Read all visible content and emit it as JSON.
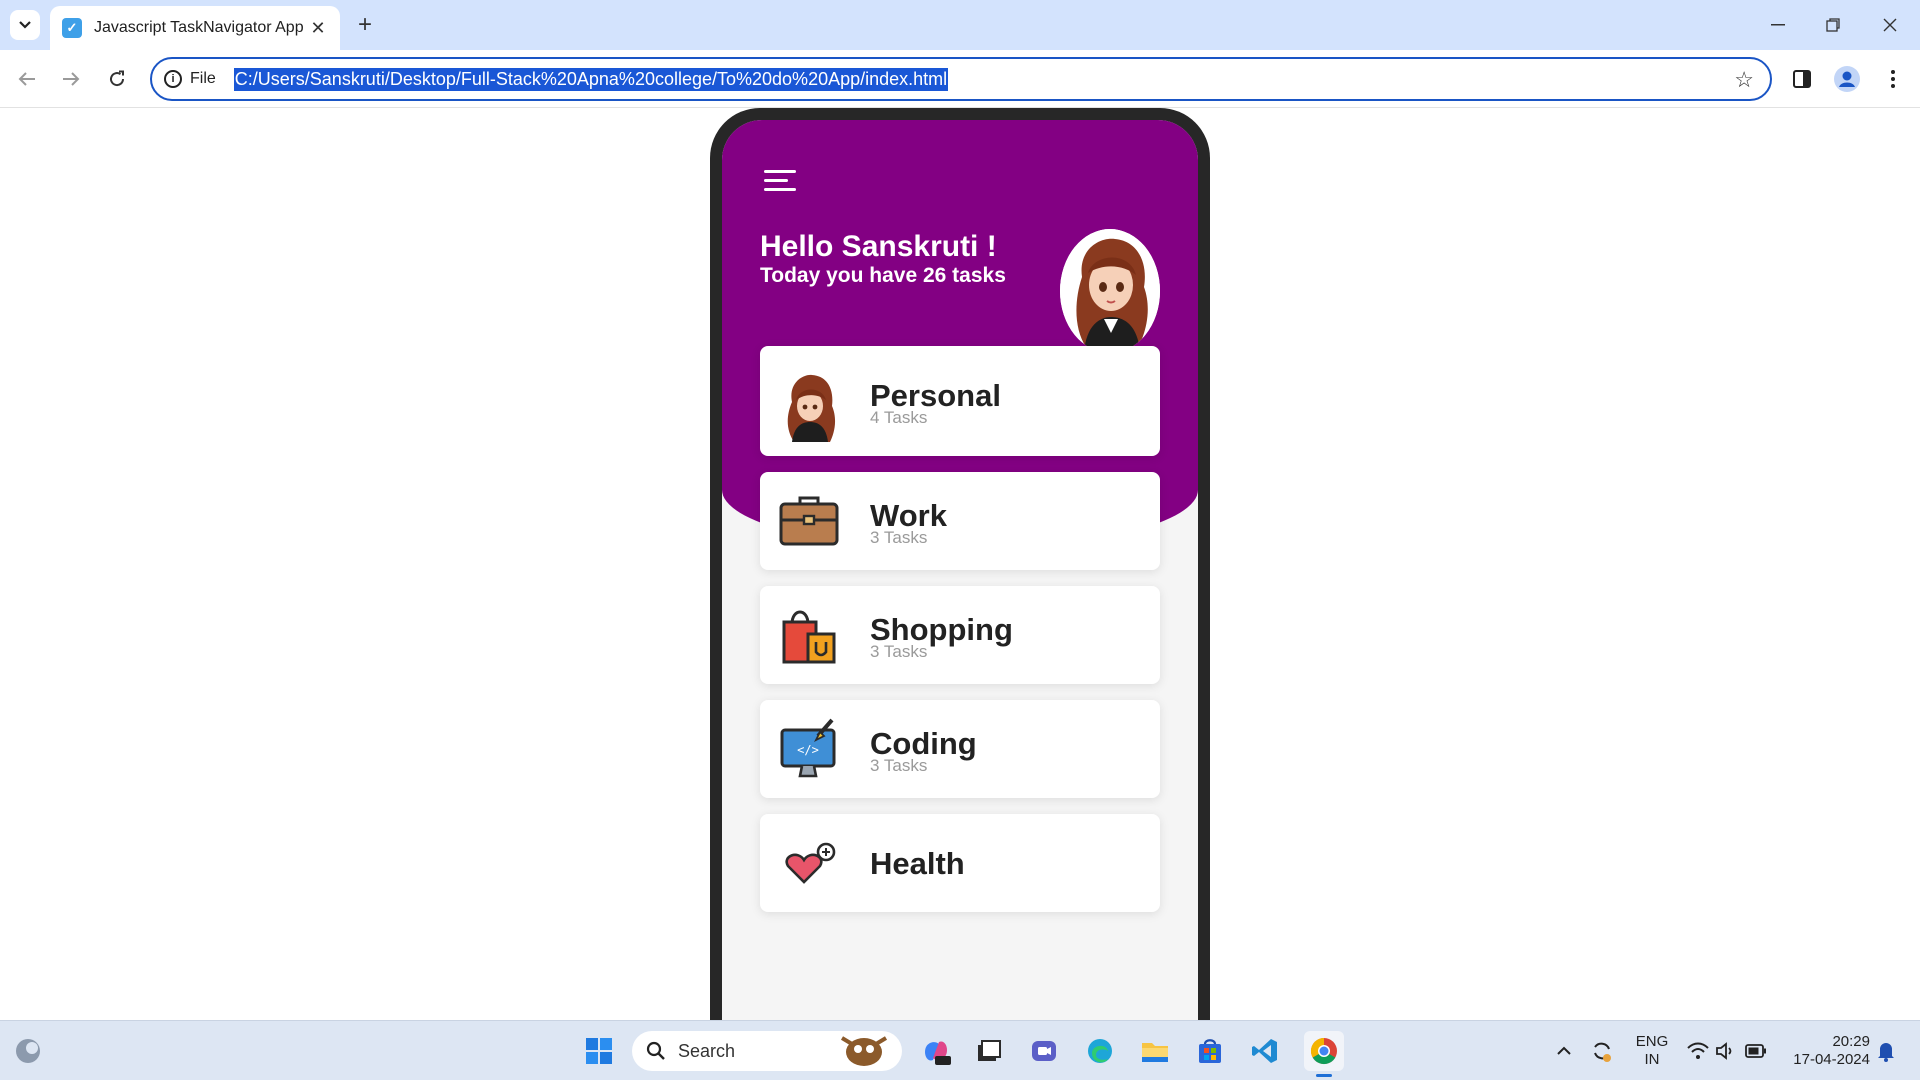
{
  "browser": {
    "tab_title": "Javascript TaskNavigator App",
    "address_chip": "File",
    "url": "C:/Users/Sanskruti/Desktop/Full-Stack%20Apna%20college/To%20do%20App/index.html"
  },
  "app": {
    "greeting": "Hello Sanskruti !",
    "subtitle": "Today you have 26 tasks",
    "categories": [
      {
        "name": "Personal",
        "count": "4 Tasks",
        "icon": "avatar-icon"
      },
      {
        "name": "Work",
        "count": "3 Tasks",
        "icon": "briefcase-icon"
      },
      {
        "name": "Shopping",
        "count": "3 Tasks",
        "icon": "shopping-bags-icon"
      },
      {
        "name": "Coding",
        "count": "3 Tasks",
        "icon": "coding-monitor-icon"
      },
      {
        "name": "Health",
        "count": "",
        "icon": "health-icon"
      }
    ],
    "colors": {
      "primary": "#830083",
      "frame": "#272727"
    }
  },
  "taskbar": {
    "search_label": "Search",
    "lang_top": "ENG",
    "lang_bottom": "IN",
    "time": "20:29",
    "date": "17-04-2024"
  }
}
